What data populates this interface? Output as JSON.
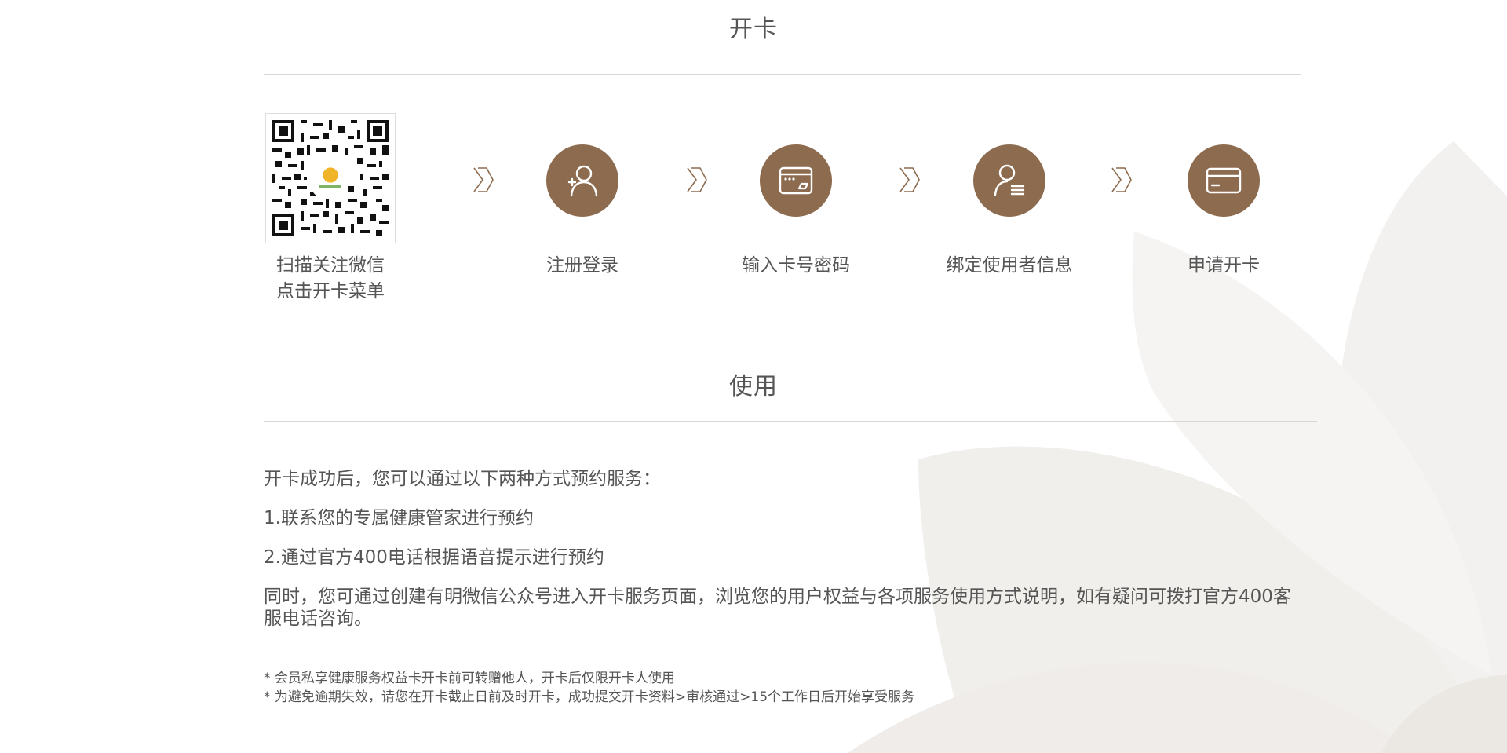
{
  "sections": {
    "open_card_title": "开卡",
    "usage_title": "使用"
  },
  "steps": [
    {
      "label_line1": "扫描关注微信",
      "label_line2": "点击开卡菜单",
      "icon": "qr-code"
    },
    {
      "label": "注册登录",
      "icon": "user-plus-icon"
    },
    {
      "label": "输入卡号密码",
      "icon": "card-input-icon"
    },
    {
      "label": "绑定使用者信息",
      "icon": "user-bind-icon"
    },
    {
      "label": "申请开卡",
      "icon": "credit-card-icon"
    }
  ],
  "usage": {
    "intro": "开卡成功后，您可以通过以下两种方式预约服务：",
    "item1": "1.联系您的专属健康管家进行预约",
    "item2": "2.通过官方400电话根据语音提示进行预约",
    "note": "同时，您可通过创建有明微信公众号进入开卡服务页面，浏览您的用户权益与各项服务使用方式说明，如有疑问可拨打官方400客服电话咨询。"
  },
  "footnotes": {
    "line1": "* 会员私享健康服务权益卡开卡前可转赠他人，开卡后仅限开卡人使用",
    "line2": "* 为避免逾期失效，请您在开卡截止日前及时开卡，成功提交开卡资料>审核通过>15个工作日后开始享受服务"
  },
  "colors": {
    "accent": "#8d6b4f",
    "text": "#555555",
    "divider": "#d9d5d0"
  }
}
